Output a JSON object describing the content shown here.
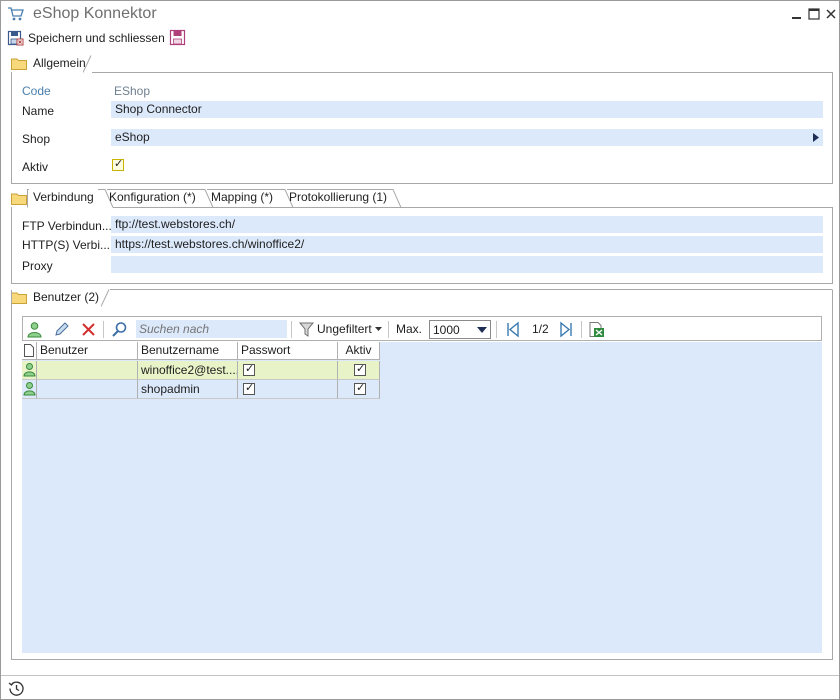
{
  "window": {
    "title": "eShop Konnektor",
    "icon": "cart-icon",
    "controls": [
      "minimize-icon",
      "maximize-icon",
      "close-icon"
    ]
  },
  "toolbar": {
    "save_close_label": "Speichern und schliessen",
    "save_icon": "save-icon"
  },
  "general": {
    "tab_label": "Allgemein",
    "code_label": "Code",
    "code_value": "EShop",
    "name_label": "Name",
    "name_value": "Shop Connector",
    "shop_label": "Shop",
    "shop_value": "eShop",
    "active_label": "Aktiv",
    "active_checked": true
  },
  "connection_tabs": {
    "tabs": [
      {
        "label": "Verbindung"
      },
      {
        "label": "Konfiguration (*)"
      },
      {
        "label": "Mapping (*)"
      },
      {
        "label": "Protokollierung (1)"
      }
    ],
    "ftp_label": "FTP  Verbindun...",
    "ftp_value": "ftp://test.webstores.ch/",
    "http_label": "HTTP(S) Verbi...",
    "http_value": "https://test.webstores.ch/winoffice2/",
    "proxy_label": "Proxy",
    "proxy_value": ""
  },
  "users": {
    "tab_label": "Benutzer (2)",
    "search_placeholder": "Suchen nach",
    "filter_label": "Ungefiltert",
    "max_label": "Max.",
    "max_value": "1000",
    "page_label": "1/2",
    "columns": [
      "Benutzer",
      "Benutzername",
      "Passwort",
      "Aktiv"
    ],
    "rows": [
      {
        "user": "",
        "username": "winoffice2@test....",
        "password": true,
        "active": true,
        "selected": true
      },
      {
        "user": "",
        "username": "shopadmin",
        "password": true,
        "active": true,
        "selected": false
      }
    ]
  },
  "colors": {
    "field_bg": "#dce9fb",
    "selected_row": "#e8f3c8",
    "accent": "#4a7fae"
  }
}
